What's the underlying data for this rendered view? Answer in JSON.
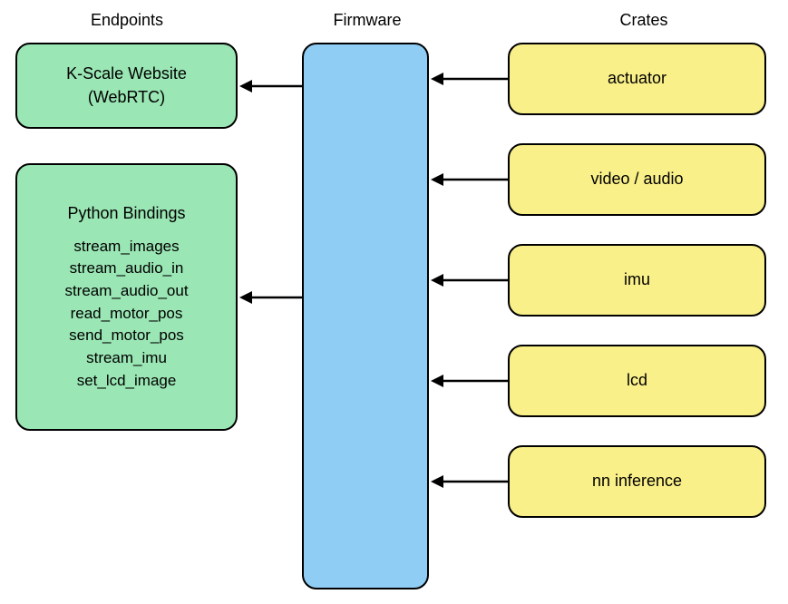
{
  "headers": {
    "endpoints": "Endpoints",
    "firmware": "Firmware",
    "crates": "Crates"
  },
  "endpoints": {
    "kscale_line1": "K-Scale Website",
    "kscale_line2": "(WebRTC)",
    "python_title": "Python Bindings",
    "python_items": {
      "i0": "stream_images",
      "i1": "stream_audio_in",
      "i2": "stream_audio_out",
      "i3": "read_motor_pos",
      "i4": "send_motor_pos",
      "i5": "stream_imu",
      "i6": "set_lcd_image"
    }
  },
  "crates": {
    "c0": "actuator",
    "c1": "video / audio",
    "c2": "imu",
    "c3": "lcd",
    "c4": "nn inference"
  }
}
